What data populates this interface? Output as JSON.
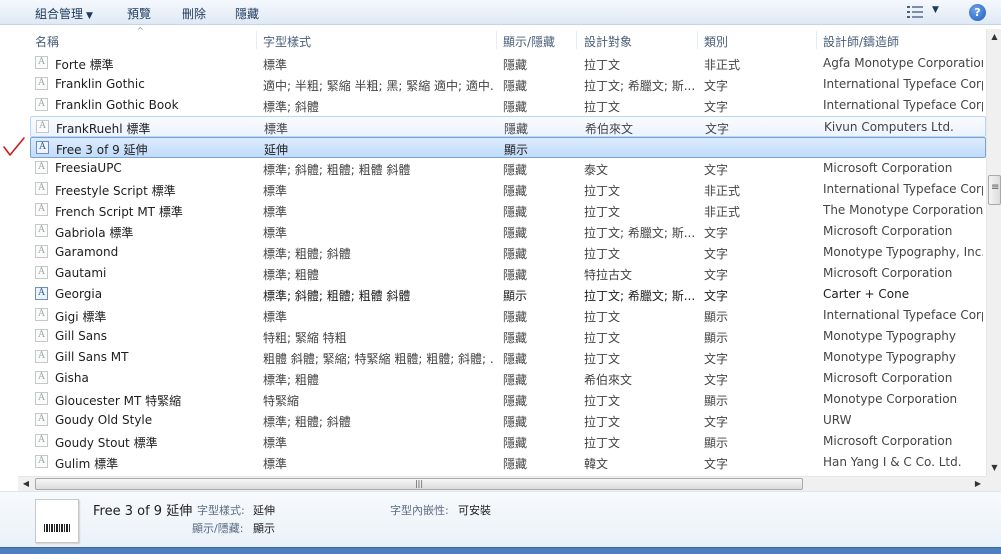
{
  "toolbar": {
    "organize_label": "組合管理",
    "preview_label": "預覽",
    "delete_label": "刪除",
    "hide_label": "隱藏",
    "help_label": "?"
  },
  "columns": [
    "名稱",
    "字型樣式",
    "顯示/隱藏",
    "設計對象",
    "類別",
    "設計師/鑄造師"
  ],
  "rows": [
    {
      "name": "Forte 標準",
      "style": "標準",
      "show": "隱藏",
      "target": "拉丁文",
      "category": "非正式",
      "designer": "Agfa Monotype Corporation",
      "shown": false
    },
    {
      "name": "Franklin Gothic",
      "style": "適中; 半粗; 緊縮 半粗; 黑; 緊縮 適中; 適中...",
      "show": "隱藏",
      "target": "拉丁文; 希臘文; 斯...",
      "category": "文字",
      "designer": "International Typeface Corporation",
      "shown": false
    },
    {
      "name": "Franklin Gothic Book",
      "style": "標準; 斜體",
      "show": "隱藏",
      "target": "拉丁文",
      "category": "文字",
      "designer": "International Typeface Corporation",
      "shown": false
    },
    {
      "name": "FrankRuehl 標準",
      "style": "標準",
      "show": "隱藏",
      "target": "希伯來文",
      "category": "文字",
      "designer": "Kivun Computers Ltd.",
      "shown": false
    },
    {
      "name": "Free 3 of 9 延伸",
      "style": "延伸",
      "show": "顯示",
      "target": "",
      "category": "",
      "designer": "",
      "shown": true
    },
    {
      "name": "FreesiaUPC",
      "style": "標準; 斜體; 粗體; 粗體 斜體",
      "show": "隱藏",
      "target": "泰文",
      "category": "文字",
      "designer": "Microsoft Corporation",
      "shown": false
    },
    {
      "name": "Freestyle Script 標準",
      "style": "標準",
      "show": "隱藏",
      "target": "拉丁文",
      "category": "非正式",
      "designer": "International Typeface Corporation",
      "shown": false
    },
    {
      "name": "French Script MT 標準",
      "style": "標準",
      "show": "隱藏",
      "target": "拉丁文",
      "category": "非正式",
      "designer": "The Monotype Corporation",
      "shown": false
    },
    {
      "name": "Gabriola 標準",
      "style": "標準",
      "show": "隱藏",
      "target": "拉丁文; 希臘文; 斯...",
      "category": "文字",
      "designer": "Microsoft Corporation",
      "shown": false
    },
    {
      "name": "Garamond",
      "style": "標準; 粗體; 斜體",
      "show": "隱藏",
      "target": "拉丁文",
      "category": "文字",
      "designer": "Monotype Typography, Inc.",
      "shown": false
    },
    {
      "name": "Gautami",
      "style": "標準; 粗體",
      "show": "隱藏",
      "target": "特拉古文",
      "category": "文字",
      "designer": "Microsoft Corporation",
      "shown": false
    },
    {
      "name": "Georgia",
      "style": "標準; 斜體; 粗體; 粗體 斜體",
      "show": "顯示",
      "target": "拉丁文; 希臘文; 斯...",
      "category": "文字",
      "designer": "Carter + Cone",
      "shown": true
    },
    {
      "name": "Gigi 標準",
      "style": "標準",
      "show": "隱藏",
      "target": "拉丁文",
      "category": "顯示",
      "designer": "International Typeface Corporation",
      "shown": false
    },
    {
      "name": "Gill Sans",
      "style": "特粗; 緊縮 特粗",
      "show": "隱藏",
      "target": "拉丁文",
      "category": "顯示",
      "designer": "Monotype Typography",
      "shown": false
    },
    {
      "name": "Gill Sans MT",
      "style": "粗體 斜體; 緊縮; 特緊縮 粗體; 粗體; 斜體; ...",
      "show": "隱藏",
      "target": "拉丁文",
      "category": "文字",
      "designer": "Monotype Typography",
      "shown": false
    },
    {
      "name": "Gisha",
      "style": "標準; 粗體",
      "show": "隱藏",
      "target": "希伯來文",
      "category": "文字",
      "designer": "Microsoft Corporation",
      "shown": false
    },
    {
      "name": "Gloucester MT 特緊縮",
      "style": "特緊縮",
      "show": "隱藏",
      "target": "拉丁文",
      "category": "顯示",
      "designer": "Monotype Corporation",
      "shown": false
    },
    {
      "name": "Goudy Old Style",
      "style": "標準; 粗體; 斜體",
      "show": "隱藏",
      "target": "拉丁文",
      "category": "文字",
      "designer": "URW",
      "shown": false
    },
    {
      "name": "Goudy Stout 標準",
      "style": "標準",
      "show": "隱藏",
      "target": "拉丁文",
      "category": "顯示",
      "designer": "Microsoft Corporation",
      "shown": false
    },
    {
      "name": "Gulim 標準",
      "style": "標準",
      "show": "隱藏",
      "target": "韓文",
      "category": "文字",
      "designer": "Han Yang I & C Co. Ltd.",
      "shown": false
    }
  ],
  "selected_index": 4,
  "hover_index": 3,
  "icon_glyph": "A",
  "details": {
    "title": "Free 3 of 9 延伸",
    "style_label": "字型樣式:",
    "style_value": "延伸",
    "show_label": "顯示/隱藏:",
    "show_value": "顯示",
    "embed_label": "字型內嵌性:",
    "embed_value": "可安裝"
  },
  "colors": {
    "selection": "#c1dcfc",
    "accent": "#4f7fbd",
    "checkmark": "#d11a1a"
  }
}
